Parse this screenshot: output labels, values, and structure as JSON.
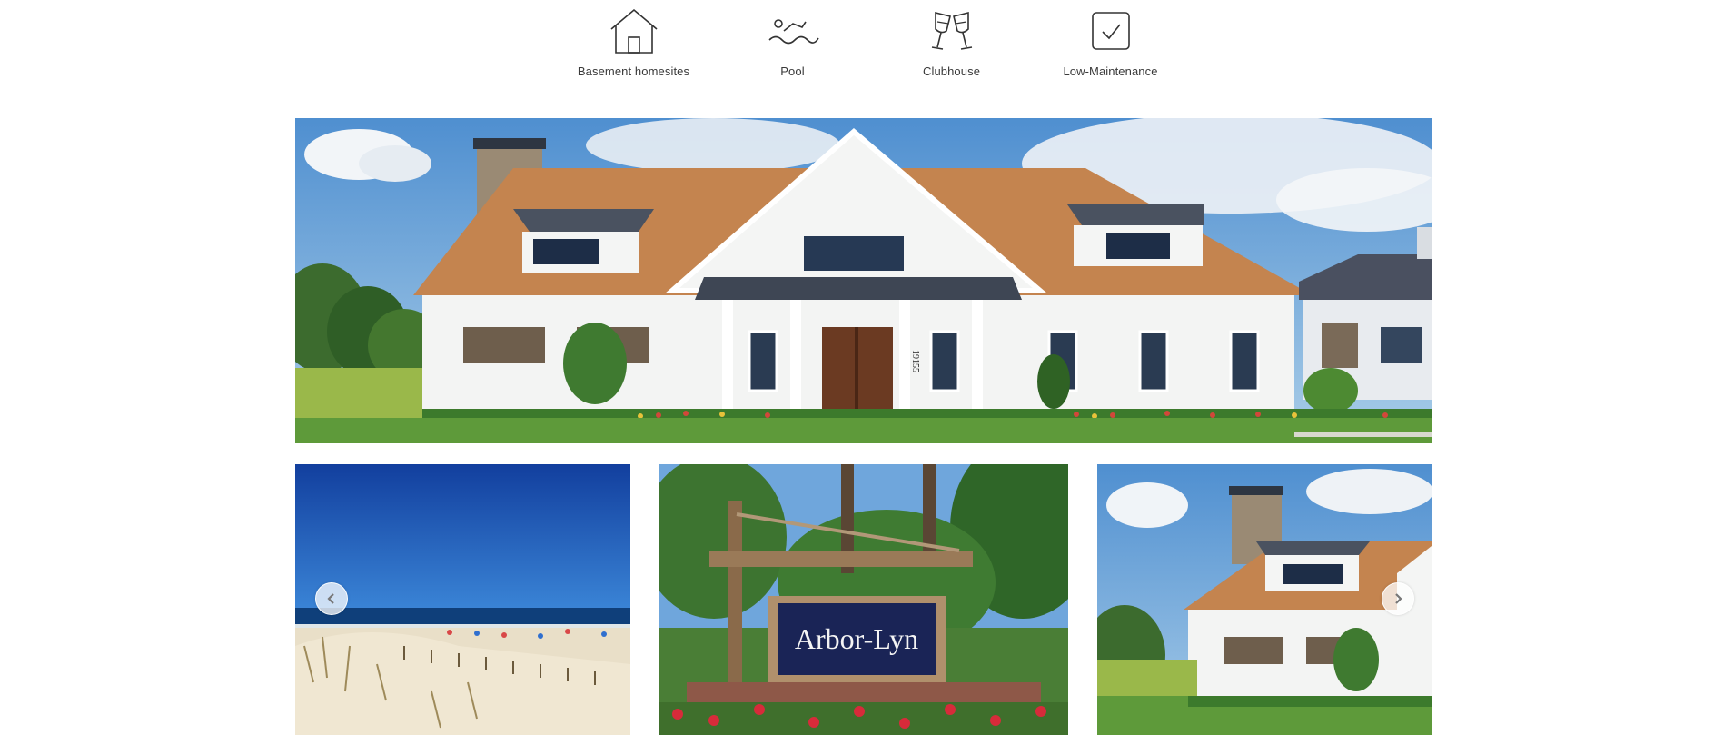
{
  "amenities": [
    {
      "label": "Basement homesites",
      "icon": "house-icon"
    },
    {
      "label": "Pool",
      "icon": "swimmer-icon"
    },
    {
      "label": "Clubhouse",
      "icon": "wine-glasses-icon"
    },
    {
      "label": "Low-Maintenance",
      "icon": "checkbox-icon"
    }
  ],
  "gallery": {
    "hero_house_number": "19155",
    "sign_text": "Arbor-Lyn",
    "prev_icon": "chevron-left-icon",
    "next_icon": "chevron-right-icon"
  },
  "colors": {
    "sky": "#5f9fd6",
    "roof": "#c4844f",
    "siding": "#f4f5f4",
    "door": "#6b3a22",
    "grass": "#5e9a3a",
    "ocean_sky": "#1b52b0",
    "sign_navy": "#1a2456"
  }
}
